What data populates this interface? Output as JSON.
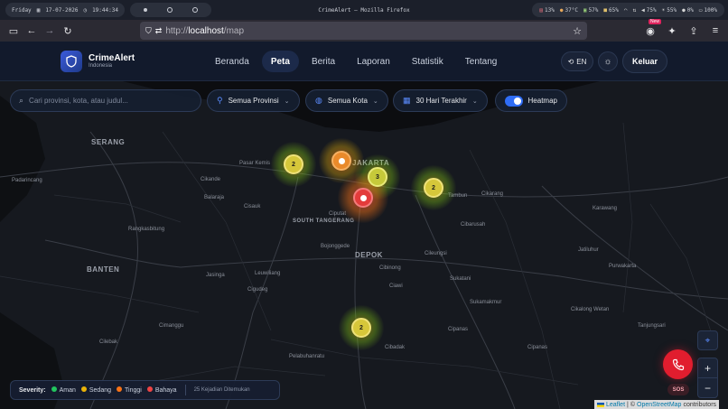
{
  "os": {
    "day": "Friday",
    "date": "17-07-2026",
    "time": "19:44:34",
    "window_title": "CrimeAlert — Mozilla Firefox",
    "stats": [
      "13%",
      "37°C",
      "57%",
      "65%",
      "75%",
      "55%",
      "0%",
      "100%"
    ]
  },
  "browser": {
    "url_prefix": "http://",
    "url_host": "localhost",
    "url_path": "/map",
    "new_badge": "New"
  },
  "brand": {
    "name": "CrimeAlert",
    "sub": "Indonesia"
  },
  "nav": {
    "items": [
      {
        "label": "Beranda"
      },
      {
        "label": "Peta"
      },
      {
        "label": "Berita"
      },
      {
        "label": "Laporan"
      },
      {
        "label": "Statistik"
      },
      {
        "label": "Tentang"
      }
    ],
    "active": "Peta",
    "lang": "EN",
    "logout": "Keluar"
  },
  "filters": {
    "search_placeholder": "Cari provinsi, kota, atau judul...",
    "province": "Semua Provinsi",
    "city": "Semua Kota",
    "period": "30 Hari Terakhir",
    "heatmap_label": "Heatmap",
    "heatmap_on": true
  },
  "map": {
    "places": [
      {
        "text": "SERANG",
        "big": true
      },
      {
        "text": "JAKARTA",
        "big": true
      },
      {
        "text": "SOUTH TANGERANG",
        "big": true
      },
      {
        "text": "DEPOK",
        "big": true
      },
      {
        "text": "BANTEN",
        "big": true
      },
      {
        "text": "Pasar Kemis"
      },
      {
        "text": "Padarincang"
      },
      {
        "text": "Cikande"
      },
      {
        "text": "Balaraja"
      },
      {
        "text": "Cisauk"
      },
      {
        "text": "Ciputat"
      },
      {
        "text": "Cikarang"
      },
      {
        "text": "Tambun"
      },
      {
        "text": "Cibarusah"
      },
      {
        "text": "Cileungsi"
      },
      {
        "text": "Ciawi"
      },
      {
        "text": "Cibinong"
      },
      {
        "text": "Cigudeg"
      },
      {
        "text": "Leuwiliang"
      },
      {
        "text": "Jasinga"
      },
      {
        "text": "Cibadak"
      },
      {
        "text": "Cipanas"
      },
      {
        "text": "Pelabuhanratu"
      },
      {
        "text": "Rangkasbitung"
      },
      {
        "text": "Karawang"
      },
      {
        "text": "Purwakarta"
      },
      {
        "text": "Jatiluhur"
      },
      {
        "text": "Cikalong Wetan"
      },
      {
        "text": "Tanjungsari"
      },
      {
        "text": "Sukatani"
      },
      {
        "text": "Sukamakmur"
      },
      {
        "text": "Cilebak"
      },
      {
        "text": "Cimanggu"
      },
      {
        "text": "Cipanas"
      },
      {
        "text": "Bojonggede"
      }
    ],
    "clusters": [
      {
        "count": "2",
        "level": "sedang"
      },
      {
        "count": "",
        "level": "tinggi"
      },
      {
        "count": "3",
        "level": "sedang"
      },
      {
        "count": "",
        "level": "bahaya"
      },
      {
        "count": "2",
        "level": "sedang"
      },
      {
        "count": "2",
        "level": "sedang"
      }
    ]
  },
  "legend": {
    "title": "Severity:",
    "items": [
      {
        "label": "Aman",
        "color": "#22c55e"
      },
      {
        "label": "Sedang",
        "color": "#eab308"
      },
      {
        "label": "Tinggi",
        "color": "#f97316"
      },
      {
        "label": "Bahaya",
        "color": "#ef4444"
      }
    ],
    "count_text": "25 Kejadian Ditemukan"
  },
  "controls": {
    "zoom_in": "+",
    "zoom_out": "−",
    "sos": "SOS"
  },
  "attribution": {
    "leaflet": "Leaflet",
    "sep": "|",
    "osm_prefix": "©",
    "osm": "OpenStreetMap",
    "suffix": "contributors"
  },
  "colors": {
    "accent": "#2f6df6",
    "danger": "#e11d2e"
  }
}
